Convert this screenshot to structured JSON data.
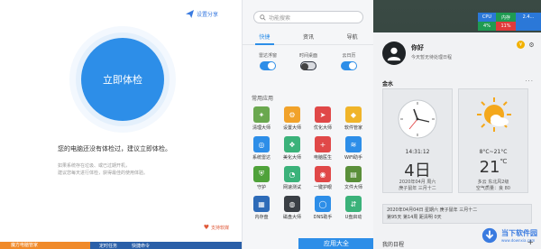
{
  "left": {
    "share_label": "设置分享",
    "check_button": "立即体检",
    "message": "您的电脑还没有体检过，建议立即体检。",
    "sub1": "如果系统存在垃圾、或已过期开机，",
    "sub2": "建议您每天进行体检，获得最佳的使用体验。",
    "feedback": "支持软媒",
    "bottom": {
      "orange": "魔方电脑管家",
      "blue_items": [
        "定时任务",
        "快捷命令"
      ]
    }
  },
  "mid": {
    "search_placeholder": "功能搜索",
    "tabs": [
      "快捷",
      "资讯",
      "导航"
    ],
    "active_tab": 0,
    "toggles": [
      {
        "label": "雷达浮窗",
        "state": "on"
      },
      {
        "label": "时间桌面",
        "state": "off"
      },
      {
        "label": "云日历",
        "state": "on"
      }
    ],
    "section_title": "常用应用",
    "apps": [
      {
        "name": "清理大师",
        "icon": "broom-icon",
        "color": "#6aa84f"
      },
      {
        "name": "设置大师",
        "icon": "gear-icon",
        "color": "#f1a22a"
      },
      {
        "name": "优化大师",
        "icon": "rocket-icon",
        "color": "#e04848"
      },
      {
        "name": "软件管家",
        "icon": "box-icon",
        "color": "#f0b429"
      },
      {
        "name": "系统雷达",
        "icon": "radar-icon",
        "color": "#2d8ee8"
      },
      {
        "name": "美化大师",
        "icon": "palette-icon",
        "color": "#3bb27a"
      },
      {
        "name": "电脑医生",
        "icon": "medkit-icon",
        "color": "#e04848"
      },
      {
        "name": "WiFi助手",
        "icon": "wifi-icon",
        "color": "#2d8ee8"
      },
      {
        "name": "守护",
        "icon": "shield-icon",
        "color": "#4fa23a"
      },
      {
        "name": "网速测试",
        "icon": "speedometer-icon",
        "color": "#3bb27a"
      },
      {
        "name": "一键护眼",
        "icon": "eye-icon",
        "color": "#e04848"
      },
      {
        "name": "文件大师",
        "icon": "folder-icon",
        "color": "#5a8f3a"
      },
      {
        "name": "内存盘",
        "icon": "chip-icon",
        "color": "#2d6bb8"
      },
      {
        "name": "磁盘大师",
        "icon": "disk-icon",
        "color": "#3a3f45"
      },
      {
        "name": "DNS助手",
        "icon": "globe-icon",
        "color": "#2d8ee8"
      },
      {
        "name": "U盘启动",
        "icon": "usb-icon",
        "color": "#3bb27a"
      }
    ],
    "app_bar": "应用大全"
  },
  "sysmon": {
    "cpu_label": "CPU",
    "mem_label": "内存",
    "cpu_value": "4%",
    "net_value": "11%",
    "mem_value": "2.4..."
  },
  "panel": {
    "hello": "你好",
    "tip": "今天暂无待处理日程",
    "section": "金水",
    "clock": {
      "time": "14:31:12",
      "day": "4日",
      "date_line": "2020年04月 周六",
      "lunar_line": "庚子鼠年 三月十二"
    },
    "weather": {
      "range": "8°C~21°C",
      "temp": "21",
      "unit": "℃",
      "desc": "多云 东北风2级",
      "aqi": "空气质量：良 80"
    },
    "calendar": {
      "line1": "2020年04月04日 星期六 庚子鼠年 三月十二",
      "line2": "第95天 第14周 距清明 0天"
    },
    "schedule_label": "我的日程"
  },
  "watermark": {
    "brand": "当下软件园",
    "url": "www.downxia.com"
  }
}
